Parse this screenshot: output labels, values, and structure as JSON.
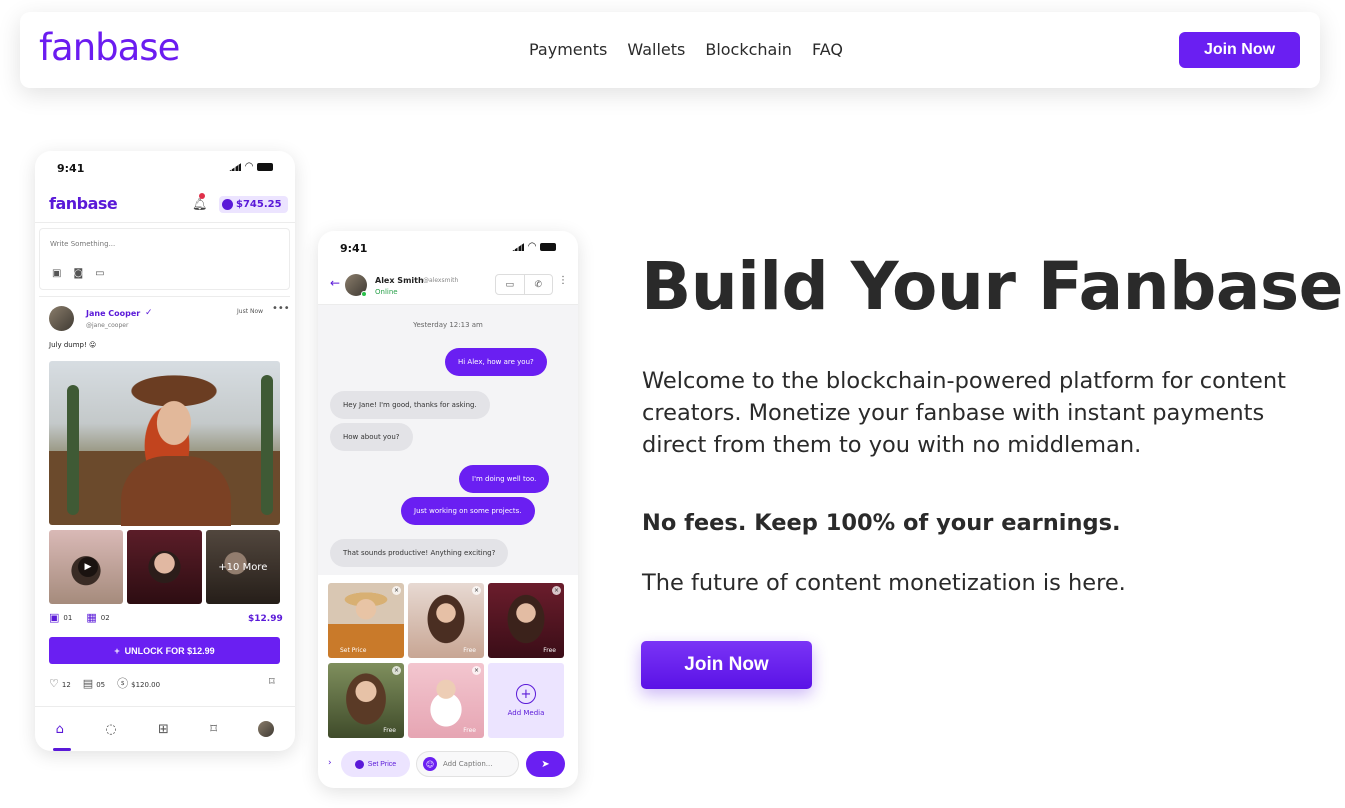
{
  "nav": {
    "brand": "fanbase",
    "links": [
      "Payments",
      "Wallets",
      "Blockchain",
      "FAQ"
    ],
    "cta": "Join Now"
  },
  "colors": {
    "brand": "#6a1ff2",
    "text": "#2a2a2a",
    "online": "#29c04a"
  },
  "phone_feed": {
    "time": "9:41",
    "brand": "fanbase",
    "notification_count": "6",
    "balance": "$745.25",
    "compose_placeholder": "Write Something...",
    "post": {
      "author": "Jane Cooper",
      "handle": "@jane_cooper",
      "time": "Just Now",
      "caption": "July dump! 😛",
      "more_overlay": "+10 More",
      "photo_count": "01",
      "video_count": "02",
      "price": "$12.99",
      "unlock_label": "UNLOCK FOR $12.99",
      "likes": "12",
      "comments": "05",
      "tips": "$120.00"
    },
    "tabs": [
      "home-icon",
      "chat-icon",
      "add-icon",
      "bookmark-icon",
      "profile-icon"
    ]
  },
  "phone_chat": {
    "time": "9:41",
    "contact_name": "Alex Smith",
    "contact_handle": "@alexsmith",
    "status": "Online",
    "date_label": "Yesterday 12:13 am",
    "messages": [
      {
        "dir": "out",
        "text": "Hi Alex, how are you?"
      },
      {
        "dir": "in",
        "text": "Hey Jane! I'm good, thanks for asking."
      },
      {
        "dir": "in",
        "text": "How about you?"
      },
      {
        "dir": "out",
        "text": "I'm doing well too."
      },
      {
        "dir": "out",
        "text": "Just working on some projects."
      },
      {
        "dir": "in",
        "text": "That sounds productive! Anything exciting?"
      }
    ],
    "media": [
      {
        "label": "Set Price"
      },
      {
        "label": "Free"
      },
      {
        "label": "Free"
      },
      {
        "label": "Free"
      },
      {
        "label": "Free"
      }
    ],
    "add_media": "Add Media",
    "set_price": "Set Price",
    "caption_placeholder": "Add Caption..."
  },
  "hero": {
    "title": "Build Your Fanbase.",
    "description": "Welcome to the blockchain-powered platform for content creators. Monetize your fanbase with instant payments direct from them to you with no middleman.",
    "fees": "No fees. Keep 100% of your earnings.",
    "future": "The future of content monetization is here.",
    "cta": "Join Now"
  }
}
